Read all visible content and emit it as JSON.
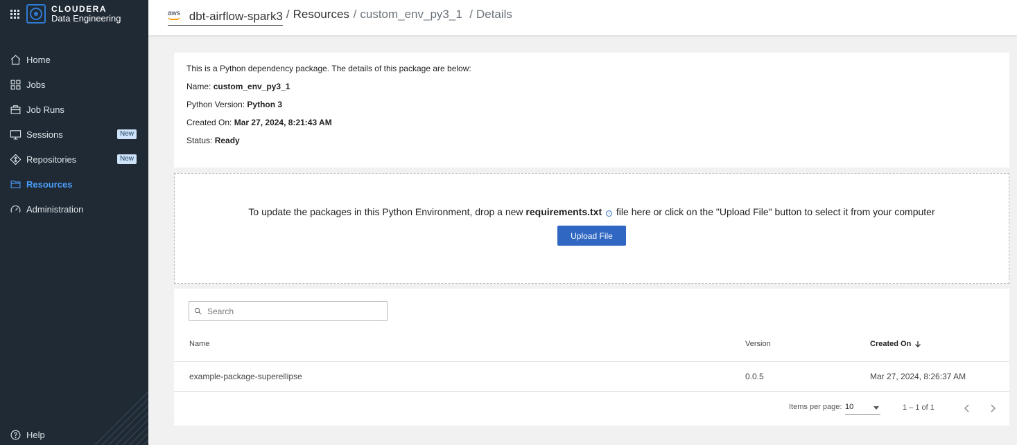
{
  "brand": {
    "name": "CLOUDERA",
    "product": "Data Engineering"
  },
  "nav": {
    "items": [
      {
        "label": "Home",
        "icon": "home-icon"
      },
      {
        "label": "Jobs",
        "icon": "grid-icon"
      },
      {
        "label": "Job Runs",
        "icon": "briefcase-icon"
      },
      {
        "label": "Sessions",
        "icon": "monitor-icon",
        "badge": "New"
      },
      {
        "label": "Repositories",
        "icon": "git-icon",
        "badge": "New"
      },
      {
        "label": "Resources",
        "icon": "folder-icon",
        "active": true
      },
      {
        "label": "Administration",
        "icon": "gauge-icon"
      }
    ],
    "help": "Help"
  },
  "breadcrumb": {
    "provider": "aws",
    "cluster": "dbt-airflow-spark3",
    "section": "Resources",
    "resource": "custom_env_py3_1",
    "page": "Details"
  },
  "info": {
    "intro": "This is a Python dependency package. The details of this package are below:",
    "name_label": "Name:",
    "name_value": "custom_env_py3_1",
    "python_label": "Python Version:",
    "python_value": "Python 3",
    "created_label": "Created On:",
    "created_value": "Mar 27, 2024, 8:21:43 AM",
    "status_label": "Status:",
    "status_value": "Ready"
  },
  "dropzone": {
    "text_before": "To update the packages in this Python Environment, drop a new",
    "filename": "requirements.txt",
    "text_after": "file here or click on the \"Upload File\" button to select it from your computer",
    "button": "Upload File"
  },
  "table": {
    "search_placeholder": "Search",
    "columns": {
      "name": "Name",
      "version": "Version",
      "created": "Created On"
    },
    "rows": [
      {
        "name": "example-package-superellipse",
        "version": "0.0.5",
        "created": "Mar 27, 2024, 8:26:37 AM"
      }
    ],
    "items_per_page_label": "Items per page:",
    "items_per_page": "10",
    "range": "1 – 1 of 1"
  },
  "colors": {
    "sidebar": "#1f2a35",
    "accent": "#2f67c2",
    "active_nav": "#4a9fff"
  }
}
